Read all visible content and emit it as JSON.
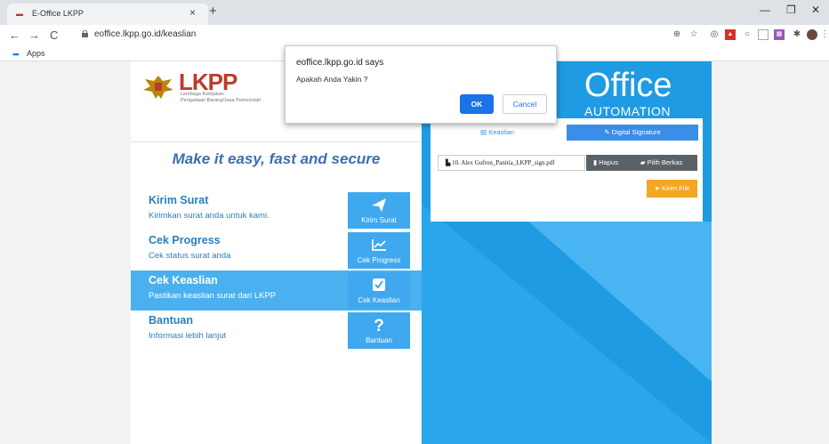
{
  "browser": {
    "tab_title": "E-Office LKPP",
    "tab_close": "×",
    "new_tab": "+",
    "url": "eoffice.lkpp.go.id/keaslian",
    "bookmarks_apps": "Apps",
    "win_minimize": "—",
    "win_maximize": "❐",
    "win_close": "✕"
  },
  "dialog": {
    "title": "eoffice.lkpp.go.id says",
    "message": "Apakah Anda Yakin ?",
    "ok_label": "OK",
    "cancel_label": "Cancel"
  },
  "brand": {
    "logo": "LKPP",
    "sub_line1": "Lembaga Kebijakan",
    "sub_line2": "Pengadaan Barang/Jasa Pemerintah",
    "tagline": "Make it easy, fast and secure"
  },
  "menu": [
    {
      "title": "Kirim Surat",
      "desc": "Kirimkan surat anda untuk kami.",
      "button": "Kirim Surat",
      "icon": "send-icon",
      "active": false
    },
    {
      "title": "Cek Progress",
      "desc": "Cek status surat anda",
      "button": "Cek Progress",
      "icon": "chart-icon",
      "active": false
    },
    {
      "title": "Cek Keaslian",
      "desc": "Pastikan keaslian surat dari LKPP",
      "button": "Cek Keaslian",
      "icon": "checkbox-icon",
      "active": true
    },
    {
      "title": "Bantuan",
      "desc": "Informasi lebih lanjut",
      "button": "Bantuan",
      "icon": "question-icon",
      "active": false
    }
  ],
  "office": {
    "title": "Office",
    "subtitle": "AUTOMATION"
  },
  "card": {
    "tab_keaslian": "Keaslian",
    "tab_digital_signature": "Digital Signature",
    "file_name": "10. Alex Gufron_Panitia_LKPP_sign.pdf",
    "hapus_label": "Hapus",
    "pilih_label": "Pilih Berkas",
    "kirim_label": "Kirim File"
  },
  "colors": {
    "accent_blue": "#1e9be3",
    "active_menu": "#4ab0f0",
    "brand_red": "#c0392b",
    "kirim_orange": "#f5a623"
  }
}
